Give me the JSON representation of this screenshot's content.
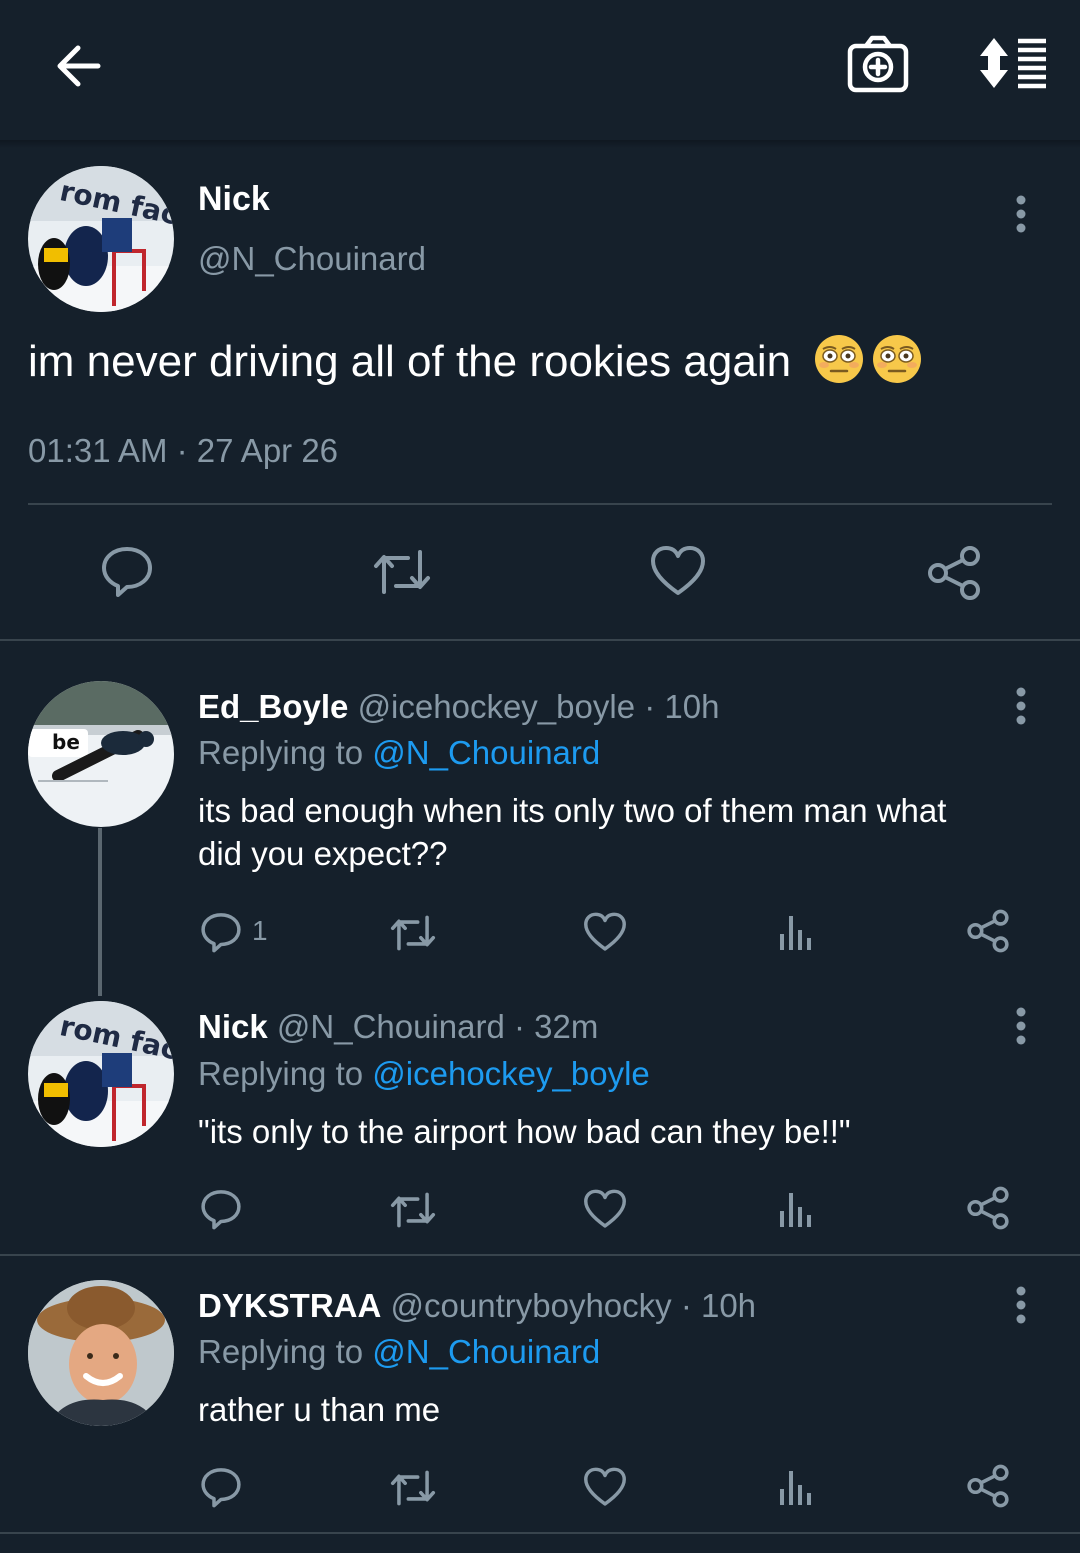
{
  "header": {
    "back_icon": "arrow-left-icon",
    "camera_icon": "camera-add-icon",
    "sort_icon": "sort-list-icon"
  },
  "main_tweet": {
    "name": "Nick",
    "handle": "@N_Chouinard",
    "text": "im never driving all of the rookies again",
    "emojis": "😳😳",
    "timestamp": "01:31 AM · 27 Apr 26"
  },
  "replies": [
    {
      "name": "Ed_Boyle",
      "meta": "@icehockey_boyle · 10h",
      "replying_prefix": "Replying to",
      "replying_to": "@N_Chouinard",
      "text_line1": "its bad enough when its only two of them man what",
      "text_line2": "did you expect??",
      "reply_count": "1"
    },
    {
      "name": "Nick",
      "meta": "@N_Chouinard · 32m",
      "replying_prefix": "Replying to",
      "replying_to": "@icehockey_boyle",
      "text_line1": "\"its only to the airport how bad can they be!!\""
    },
    {
      "name": "DYKSTRAA",
      "meta": "@countryboyhocky · 10h",
      "replying_prefix": "Replying to",
      "replying_to": "@N_Chouinard",
      "text_line1": "rather u than me"
    }
  ],
  "colors": {
    "background": "#15202b",
    "muted": "#8899a6",
    "link": "#1d9bf0",
    "divider": "#38444d"
  }
}
